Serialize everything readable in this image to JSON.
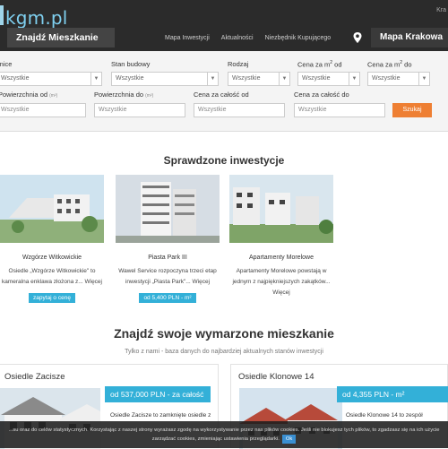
{
  "header": {
    "logo": "kgm.pl",
    "top_right": "Kra",
    "nav_title": "Znajdź Mieszkanie",
    "links": [
      "Mapa Inwestycji",
      "Aktualności",
      "Niezbędnik Kupującego"
    ],
    "map_button": "Mapa Krakowa"
  },
  "filters": {
    "labels": [
      "Dzielnice",
      "Stan budowy",
      "Rodzaj",
      "Cena za m",
      "Cena za m",
      "Powierzchnia od",
      "Powierzchnia do",
      "Cena za całość od",
      "Cena za całość do"
    ],
    "label_sup": "2",
    "label_from": " od",
    "label_to": " do",
    "unit_m2": "(m²)",
    "select_value": "Wszystkie",
    "search_button": "Szukaj"
  },
  "verified": {
    "title": "Sprawdzone inwestycje",
    "cards": [
      {
        "name": "Wzgórze Witkowickie",
        "desc1": "Osiedle „Wzgórze Witkowickie\" to",
        "desc2": "kameralna enklawa złożona z... Więcej",
        "button": "zapytaj o cenę"
      },
      {
        "name": "Piasta Park III",
        "desc1": "Wawel Service rozpoczyna trzeci etap",
        "desc2": "inwestycji „Piasta Park\"... Więcej",
        "button": "od 5,400 PLN - m²"
      },
      {
        "name": "Apartamenty Morelowe",
        "desc1": "Apartamenty Morelowe powstają w",
        "desc2": "jednym z najpiękniejszych zakątków...",
        "desc3": "Więcej",
        "button": ""
      }
    ]
  },
  "dream": {
    "title": "Znajdź swoje wymarzone mieszkanie",
    "subtitle": "Tylko z nami - baza danych do najbardziej aktualnych stanów inwestycji"
  },
  "offers": [
    {
      "title": "Osiedle Zacisze",
      "price": "od 537,000 PLN - za całość",
      "desc1": "Osiedle Zacisze to zamknięte osiedle z"
    },
    {
      "title": "Osiedle Klonowe 14",
      "price": "od 4,355 PLN - m²",
      "desc1": "Osiedle Klonowe 14 to zespół"
    }
  ],
  "cookie": {
    "line1": "...su oraz do celów statystycznych. Korzystając z naszej strony wyrażasz zgodę na wykorzystywanie przez nas plików cookies. Jeśli nie blokujesz tych plików, to zgadzasz się na ich użycie",
    "line2": "zarządzać cookies, zmieniając ustawienia przeglądarki.",
    "ok": "Ok"
  },
  "colors": {
    "header": "#2b2b2b",
    "accent": "#33b0d8",
    "button": "#ee7f33"
  }
}
